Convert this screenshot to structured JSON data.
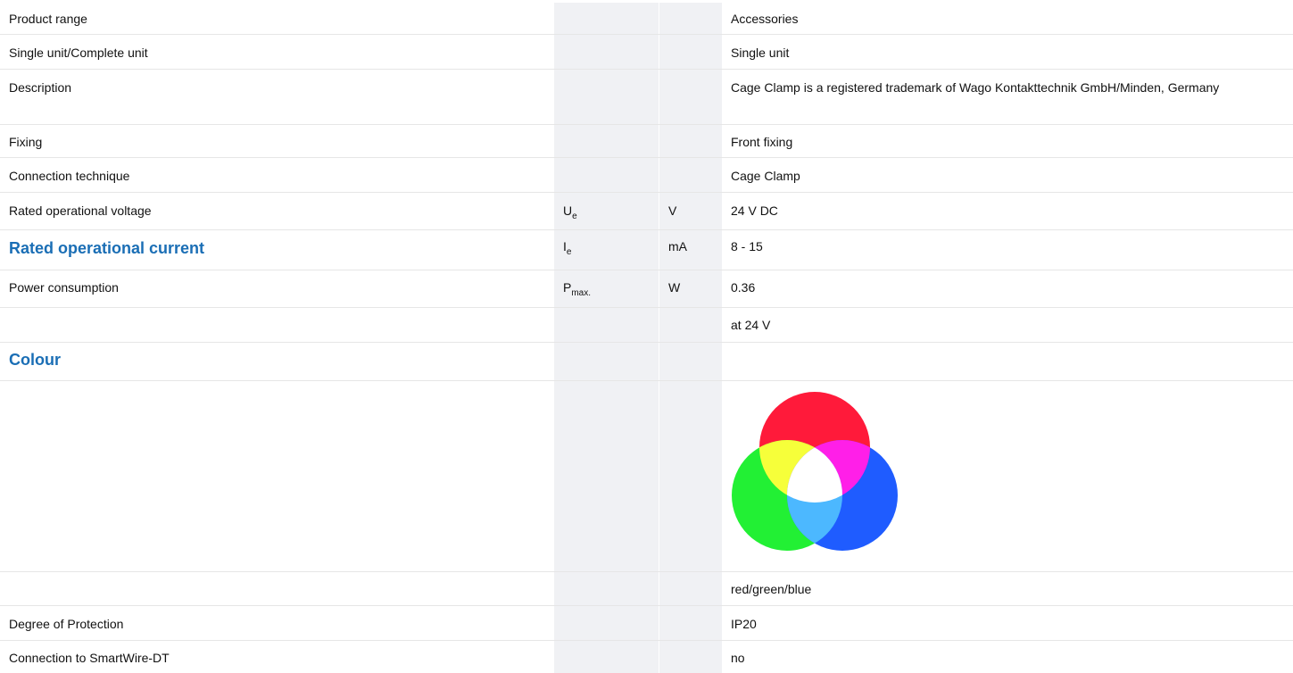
{
  "rows": [
    {
      "label": "Product range",
      "symbol": "",
      "symbol_sub": "",
      "unit": "",
      "value": "Accessories"
    },
    {
      "label": "Single unit/Complete unit",
      "symbol": "",
      "symbol_sub": "",
      "unit": "",
      "value": "Single unit"
    },
    {
      "label": "Description",
      "symbol": "",
      "symbol_sub": "",
      "unit": "",
      "value": "Cage Clamp is a registered trademark of Wago Kontakttechnik GmbH/Minden, Germany"
    },
    {
      "label": "Fixing",
      "symbol": "",
      "symbol_sub": "",
      "unit": "",
      "value": "Front fixing"
    },
    {
      "label": "Connection technique",
      "symbol": "",
      "symbol_sub": "",
      "unit": "",
      "value": "Cage Clamp"
    },
    {
      "label": "Rated operational voltage",
      "symbol": "U",
      "symbol_sub": "e",
      "unit": "V",
      "value": "24 V DC"
    },
    {
      "label": "Rated operational current",
      "symbol": "I",
      "symbol_sub": "e",
      "unit": "mA",
      "value": "8 - 15"
    },
    {
      "label": "Power consumption",
      "symbol": "P",
      "symbol_sub": "max.",
      "unit": "W",
      "value": "0.36"
    },
    {
      "label": "",
      "symbol": "",
      "symbol_sub": "",
      "unit": "",
      "value": "at 24 V"
    },
    {
      "label": "Colour",
      "symbol": "",
      "symbol_sub": "",
      "unit": "",
      "value": ""
    },
    {
      "label": "",
      "symbol": "",
      "symbol_sub": "",
      "unit": "",
      "value": ""
    },
    {
      "label": "",
      "symbol": "",
      "symbol_sub": "",
      "unit": "",
      "value": "red/green/blue"
    },
    {
      "label": "Degree of Protection",
      "symbol": "",
      "symbol_sub": "",
      "unit": "",
      "value": "IP20"
    },
    {
      "label": "Connection to SmartWire-DT",
      "symbol": "",
      "symbol_sub": "",
      "unit": "",
      "value": "no"
    }
  ],
  "colors": {
    "highlight": "#1a6eb5",
    "red": "#ff1a3a",
    "green": "#22f034",
    "blue": "#1f5cff",
    "yellow": "#f6ff3a",
    "magenta": "#ff1fe8",
    "cyan": "#4cb8ff",
    "white": "#ffffff"
  },
  "icons": {
    "colour_swatch": "rgb-venn-icon"
  }
}
